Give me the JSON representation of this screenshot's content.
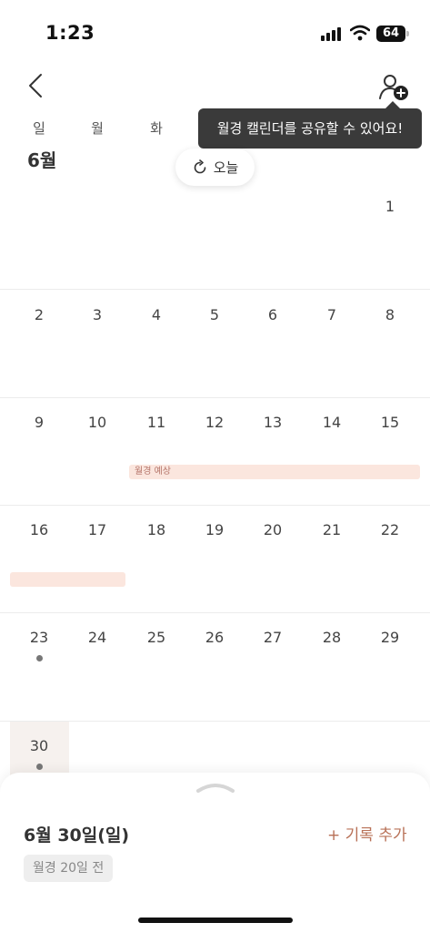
{
  "status": {
    "time": "1:23",
    "battery": "64"
  },
  "tooltip": {
    "text": "월경 캘린더를 공유할 수 있어요!"
  },
  "weekdays": [
    "일",
    "월",
    "화"
  ],
  "month_title": "6월",
  "today_button": {
    "label": "오늘"
  },
  "days": [
    "1",
    "2",
    "3",
    "4",
    "5",
    "6",
    "7",
    "8",
    "9",
    "10",
    "11",
    "12",
    "13",
    "14",
    "15",
    "16",
    "17",
    "18",
    "19",
    "20",
    "21",
    "22",
    "23",
    "24",
    "25",
    "26",
    "27",
    "28",
    "29",
    "30"
  ],
  "period": {
    "label": "월경 예상"
  },
  "sheet": {
    "date": "6월 30일(일)",
    "add_record": "+ 기록 추가",
    "badge": "월경 20일 전"
  },
  "colors": {
    "accent": "#b87157",
    "period_fill": "#fbe6de",
    "tooltip_bg": "#3a3a3a"
  }
}
